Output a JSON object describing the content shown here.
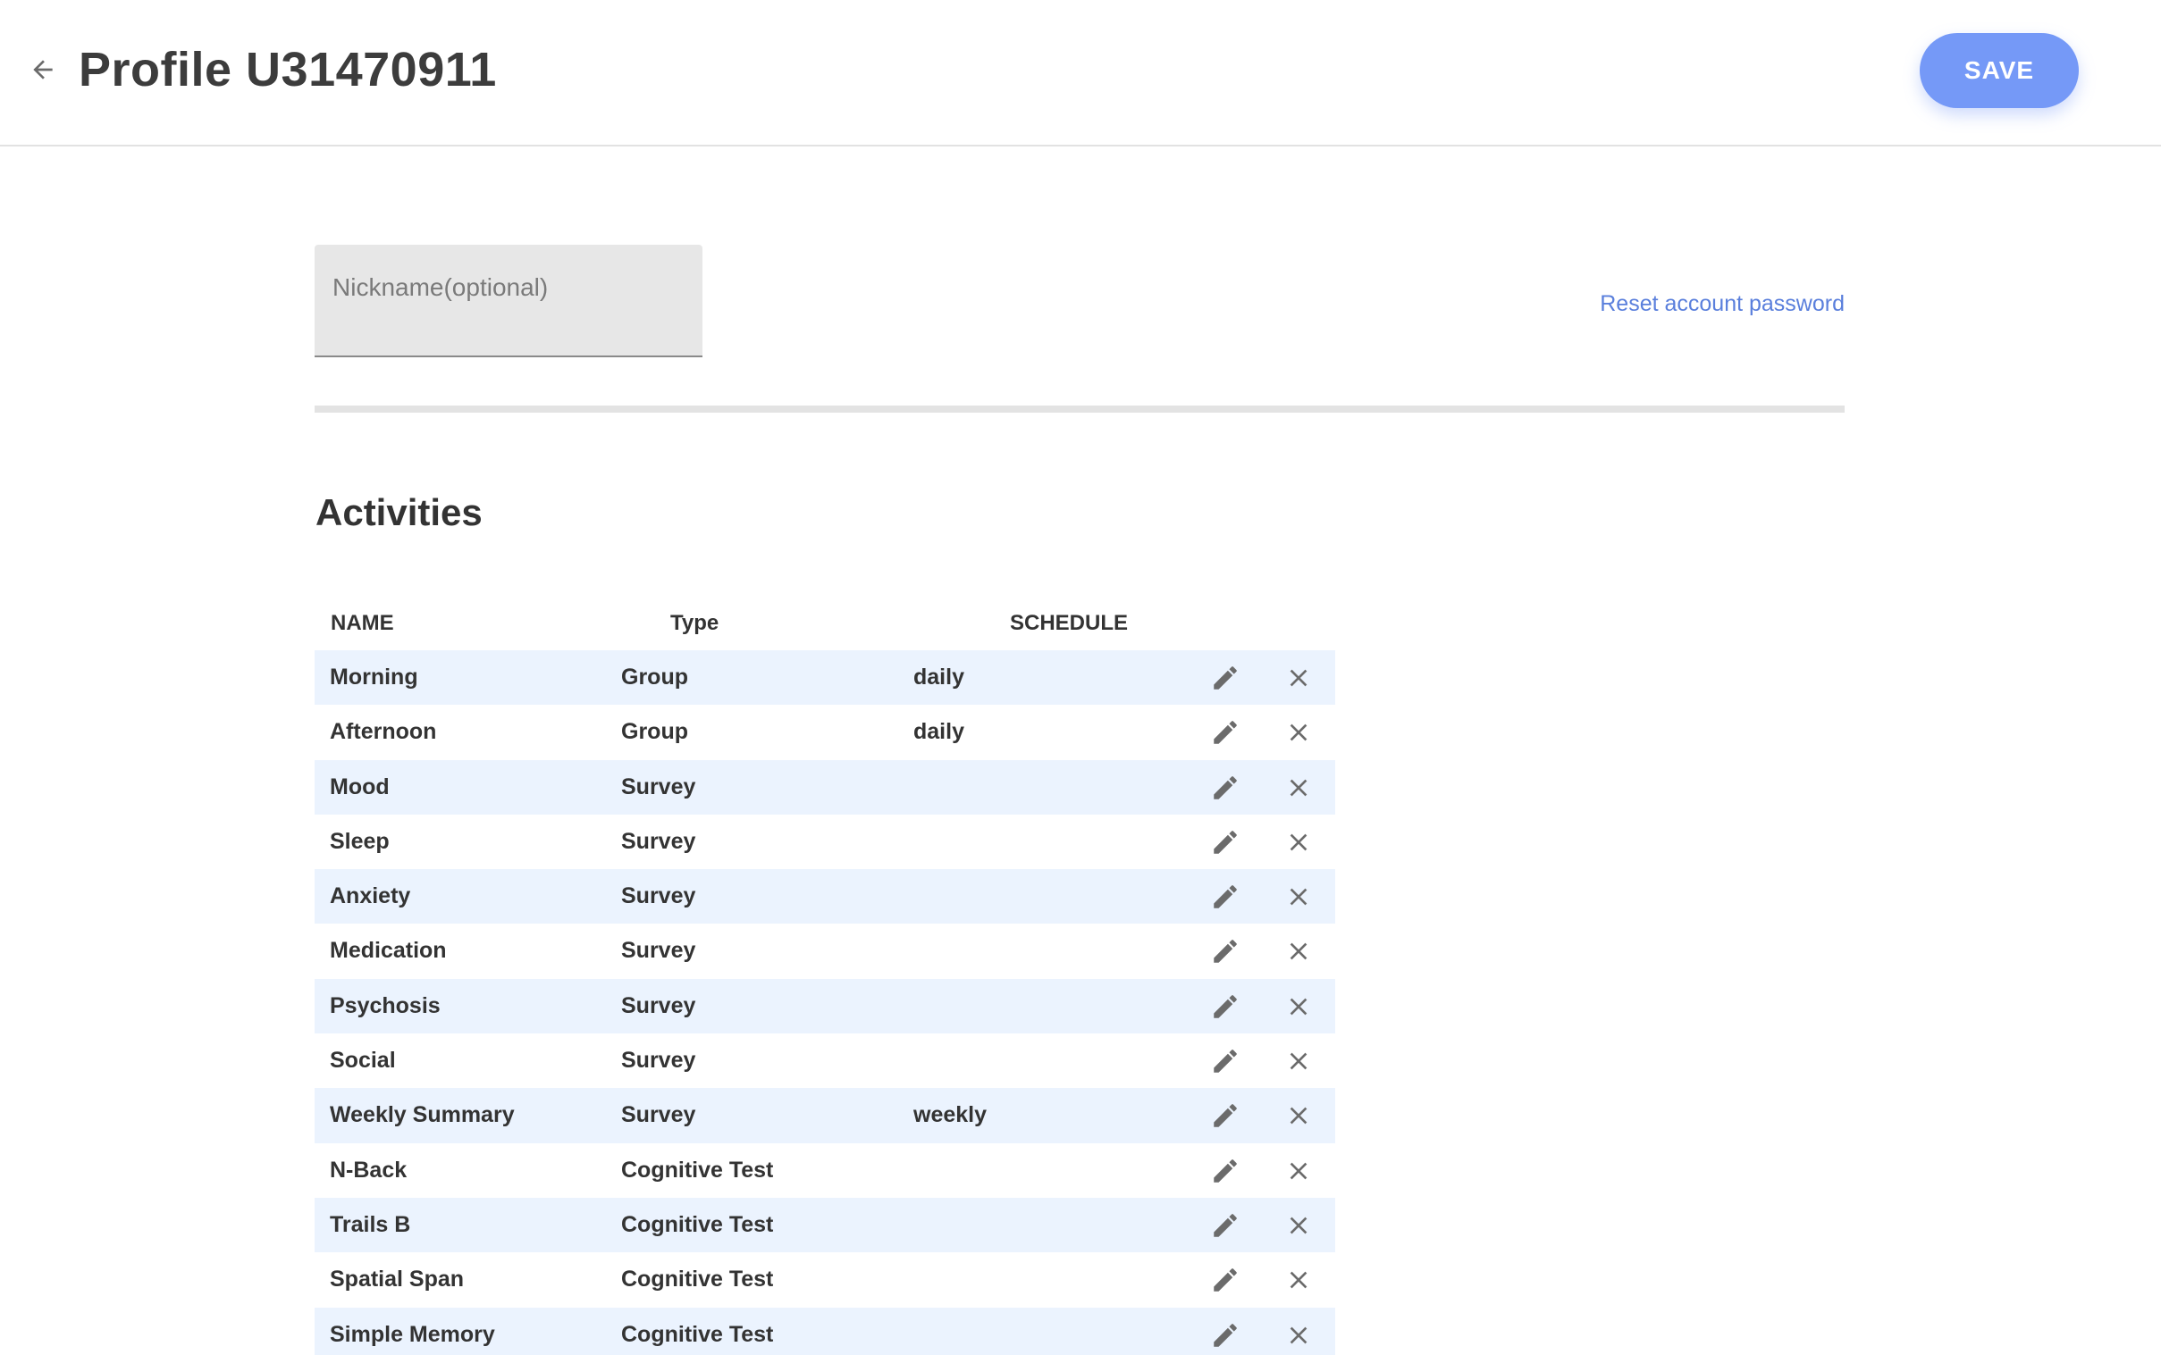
{
  "header": {
    "back_icon": "arrow-left-icon",
    "title": "Profile U31470911",
    "save_label": "SAVE"
  },
  "profile": {
    "nickname_placeholder": "Nickname(optional)",
    "nickname_value": "",
    "reset_password_label": "Reset account password"
  },
  "activities": {
    "title": "Activities",
    "columns": [
      "NAME",
      "Type",
      "SCHEDULE"
    ],
    "rows": [
      {
        "name": "Morning",
        "type": "Group",
        "schedule": "daily"
      },
      {
        "name": "Afternoon",
        "type": "Group",
        "schedule": "daily"
      },
      {
        "name": "Mood",
        "type": "Survey",
        "schedule": ""
      },
      {
        "name": "Sleep",
        "type": "Survey",
        "schedule": ""
      },
      {
        "name": "Anxiety",
        "type": "Survey",
        "schedule": ""
      },
      {
        "name": "Medication",
        "type": "Survey",
        "schedule": ""
      },
      {
        "name": "Psychosis",
        "type": "Survey",
        "schedule": ""
      },
      {
        "name": "Social",
        "type": "Survey",
        "schedule": ""
      },
      {
        "name": "Weekly Summary",
        "type": "Survey",
        "schedule": "weekly"
      },
      {
        "name": "N-Back",
        "type": "Cognitive Test",
        "schedule": ""
      },
      {
        "name": "Trails B",
        "type": "Cognitive Test",
        "schedule": ""
      },
      {
        "name": "Spatial Span",
        "type": "Cognitive Test",
        "schedule": ""
      },
      {
        "name": "Simple Memory",
        "type": "Cognitive Test",
        "schedule": ""
      }
    ],
    "row_actions": [
      "pencil-icon",
      "close-icon"
    ]
  },
  "colors": {
    "accent": "#7599f7",
    "link": "#5a7fdc",
    "row_alt": "#ebf3fe"
  }
}
